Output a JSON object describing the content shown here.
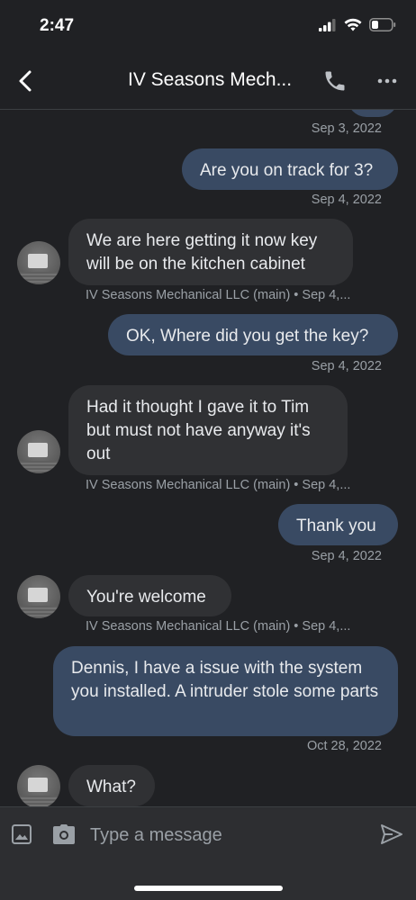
{
  "status_bar": {
    "time": "2:47"
  },
  "header": {
    "title": "IV Seasons Mech..."
  },
  "messages": [
    {
      "direction": "out",
      "text": "Are you on track for 3?",
      "meta": "Sep 4, 2022"
    },
    {
      "direction": "in",
      "text": "We are here getting it now key will be on the kitchen cabinet",
      "meta": "IV Seasons Mechanical LLC (main) • Sep 4,..."
    },
    {
      "direction": "out",
      "text": "OK, Where did you get the key?",
      "meta": "Sep 4, 2022"
    },
    {
      "direction": "in",
      "text": "Had it thought I gave it to Tim but must not have anyway it's out",
      "meta": "IV Seasons Mechanical LLC (main) • Sep 4,..."
    },
    {
      "direction": "out",
      "text": "Thank you",
      "meta": "Sep 4, 2022"
    },
    {
      "direction": "in",
      "text": "You're welcome",
      "meta": "IV Seasons Mechanical LLC (main) • Sep 4,..."
    },
    {
      "direction": "out",
      "text": "Dennis, I have a issue with the system you installed. A intruder stole some parts",
      "meta": "Oct 28, 2022"
    },
    {
      "direction": "in",
      "text": "What?"
    }
  ],
  "previous_meta": "Sep 3, 2022",
  "composer": {
    "placeholder": "Type a message"
  },
  "colors": {
    "background": "#202124",
    "outgoing_bubble": "#394a63",
    "incoming_bubble": "#303134",
    "meta_text": "#9aa0a6"
  },
  "icons": [
    "back-arrow-icon",
    "phone-icon",
    "more-icon",
    "gallery-icon",
    "camera-icon",
    "send-icon",
    "signal-icon",
    "wifi-icon",
    "battery-icon"
  ]
}
